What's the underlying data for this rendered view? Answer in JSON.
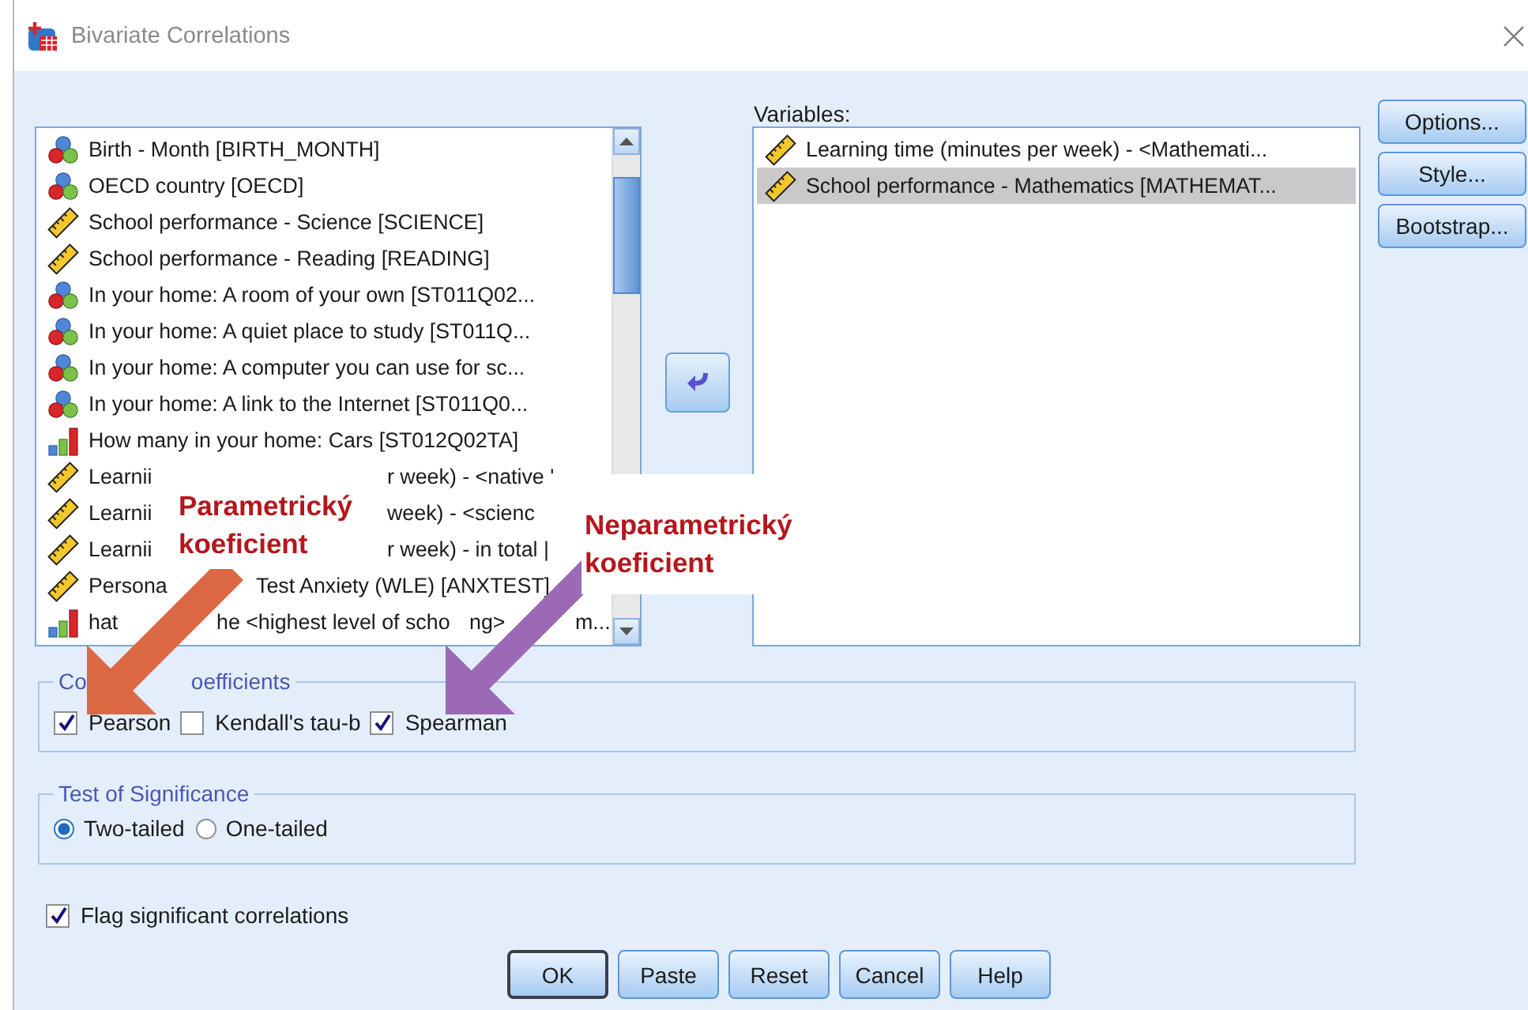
{
  "window": {
    "title": "Bivariate Correlations"
  },
  "source_list": {
    "items": [
      {
        "kind": "nominal",
        "segments": [
          "Birth - Month [BIRTH_MONTH]"
        ]
      },
      {
        "kind": "nominal",
        "segments": [
          "OECD country [OECD]"
        ]
      },
      {
        "kind": "scale",
        "segments": [
          "School performance - Science [SCIENCE]"
        ]
      },
      {
        "kind": "scale",
        "segments": [
          "School performance - Reading [READING]"
        ]
      },
      {
        "kind": "nominal",
        "segments": [
          "In your home: A room of your own [ST011Q02..."
        ]
      },
      {
        "kind": "nominal",
        "segments": [
          "In your home: A quiet place to study [ST011Q..."
        ]
      },
      {
        "kind": "nominal",
        "segments": [
          "In your home: A computer you can use for sc..."
        ]
      },
      {
        "kind": "nominal",
        "segments": [
          "In your home: A link to the Internet [ST011Q0..."
        ]
      },
      {
        "kind": "ordinal",
        "segments": [
          "How many in your home: Cars [ST012Q02TA]"
        ]
      },
      {
        "kind": "scale",
        "segments": [
          "Learnii",
          "r week) - <native '"
        ]
      },
      {
        "kind": "scale",
        "segments": [
          "Learnii",
          "week) - <scienc"
        ]
      },
      {
        "kind": "scale",
        "segments": [
          "Learnii",
          "r week) - in total |"
        ]
      },
      {
        "kind": "scale",
        "segments": [
          "Persona",
          "Test Anxiety (WLE) [ANXTEST]"
        ]
      },
      {
        "kind": "ordinal",
        "segments": [
          "hat",
          "he <highest level of scho",
          "ng>",
          "m..."
        ]
      }
    ]
  },
  "variables": {
    "label": "Variables:",
    "items": [
      {
        "kind": "scale",
        "selected": false,
        "text": "Learning time (minutes per week) - <Mathemati..."
      },
      {
        "kind": "scale",
        "selected": true,
        "text": "School performance - Mathematics [MATHEMAT..."
      }
    ]
  },
  "side_buttons": [
    "Options...",
    "Style...",
    "Bootstrap..."
  ],
  "correlation_coefficients": {
    "legend": [
      "Co",
      "oefficients"
    ],
    "options": [
      {
        "label": "Pearson",
        "checked": true
      },
      {
        "label": "Kendall's tau-b",
        "checked": false
      },
      {
        "label": "Spearman",
        "checked": true
      }
    ]
  },
  "test_of_significance": {
    "legend": "Test of Significance",
    "options": [
      {
        "label": "Two-tailed",
        "selected": true
      },
      {
        "label": "One-tailed",
        "selected": false
      }
    ]
  },
  "flag": {
    "label": "Flag significant correlations",
    "checked": true
  },
  "buttons": [
    {
      "label": "OK",
      "default": true
    },
    {
      "label": "Paste",
      "default": false
    },
    {
      "label": "Reset",
      "default": false
    },
    {
      "label": "Cancel",
      "default": false
    },
    {
      "label": "Help",
      "default": false
    }
  ],
  "annotations": [
    {
      "label": "Parametrický koeficient",
      "color": "#dc6843"
    },
    {
      "label": "Neparametrický koeficient",
      "color": "#9b69b6"
    }
  ]
}
